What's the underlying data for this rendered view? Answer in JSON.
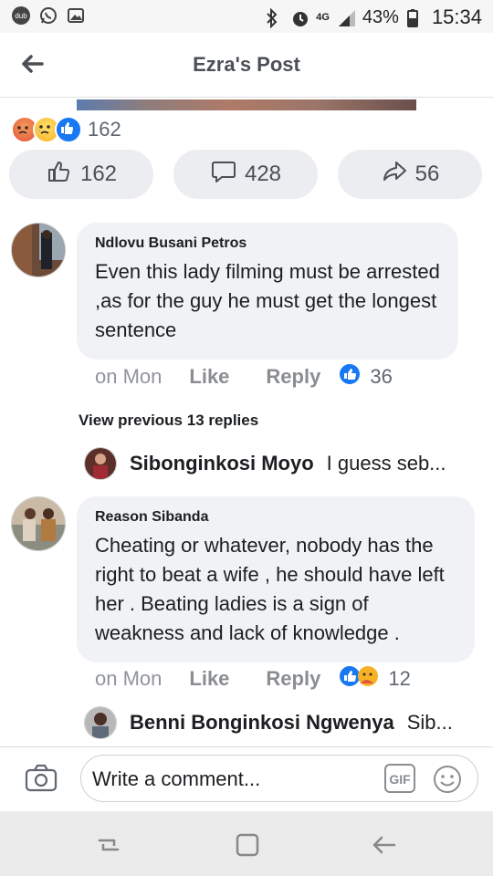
{
  "status_bar": {
    "network": "4G",
    "battery": "43%",
    "time": "15:34",
    "left_icons": [
      "dub-icon",
      "whatsapp-icon",
      "gallery-icon"
    ]
  },
  "header": {
    "title": "Ezra's Post"
  },
  "reactions": {
    "count": "162",
    "icons": [
      "angry",
      "sad",
      "like"
    ]
  },
  "actions": {
    "likes": "162",
    "comments": "428",
    "shares": "56"
  },
  "comments": [
    {
      "name": "Ndlovu Busani Petros",
      "text": "Even this lady filming must be arrested ,as for the guy he must get the longest sentence",
      "time": "on Mon",
      "like_label": "Like",
      "reply_label": "Reply",
      "reaction_count": "36",
      "view_previous": "View previous 13 replies",
      "reply_preview": {
        "name": "Sibonginkosi Moyo",
        "text": "I guess seb..."
      }
    },
    {
      "name": "Reason Sibanda",
      "text": "Cheating or  whatever, nobody has the right to beat a  wife , he should have left her . Beating ladies is a sign of weakness and lack of knowledge .",
      "time": "on Mon",
      "like_label": "Like",
      "reply_label": "Reply",
      "reaction_count": "12",
      "reply_preview": {
        "name": "Benni Bonginkosi Ngwenya",
        "text": "Sib..."
      }
    }
  ],
  "composer": {
    "placeholder": "Write a comment...",
    "gif_label": "GIF"
  },
  "colors": {
    "like_blue": "#1877f2",
    "bubble": "#f0f2f5",
    "meta_gray": "#8a8d91"
  }
}
